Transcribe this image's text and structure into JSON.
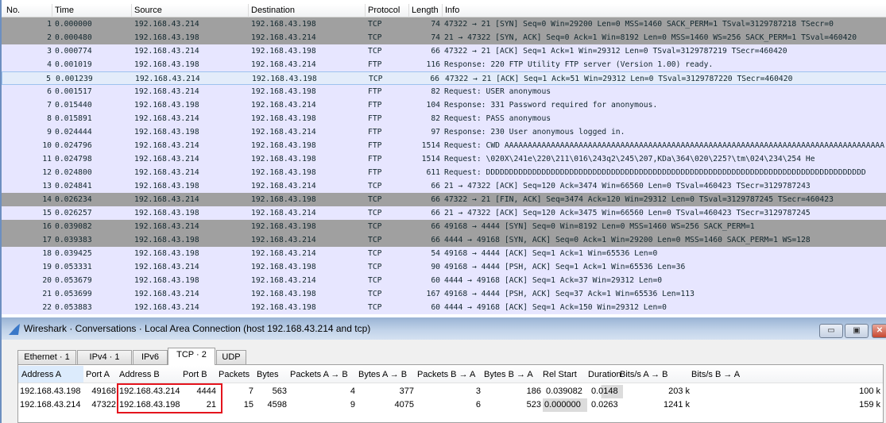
{
  "packet_list": {
    "columns": [
      "No.",
      "Time",
      "Source",
      "Destination",
      "Protocol",
      "Length",
      "Info"
    ],
    "rows": [
      {
        "no": "1",
        "time": "0.000000",
        "src": "192.168.43.214",
        "dst": "192.168.43.198",
        "proto": "TCP",
        "len": "74",
        "info": "47322 → 21 [SYN] Seq=0 Win=29200 Len=0 MSS=1460 SACK_PERM=1 TSval=3129787218 TSecr=0",
        "color": "gray"
      },
      {
        "no": "2",
        "time": "0.000480",
        "src": "192.168.43.198",
        "dst": "192.168.43.214",
        "proto": "TCP",
        "len": "74",
        "info": "21 → 47322 [SYN, ACK] Seq=0 Ack=1 Win=8192 Len=0 MSS=1460 WS=256 SACK_PERM=1 TSval=460420",
        "color": "gray"
      },
      {
        "no": "3",
        "time": "0.000774",
        "src": "192.168.43.214",
        "dst": "192.168.43.198",
        "proto": "TCP",
        "len": "66",
        "info": "47322 → 21 [ACK] Seq=1 Ack=1 Win=29312 Len=0 TSval=3129787219 TSecr=460420",
        "color": "lavender"
      },
      {
        "no": "4",
        "time": "0.001019",
        "src": "192.168.43.198",
        "dst": "192.168.43.214",
        "proto": "FTP",
        "len": "116",
        "info": "Response: 220 FTP Utility FTP server (Version 1.00) ready.",
        "color": "lavender"
      },
      {
        "no": "5",
        "time": "0.001239",
        "src": "192.168.43.214",
        "dst": "192.168.43.198",
        "proto": "TCP",
        "len": "66",
        "info": "47322 → 21 [ACK] Seq=1 Ack=51 Win=29312 Len=0 TSval=3129787220 TSecr=460420",
        "color": "selected"
      },
      {
        "no": "6",
        "time": "0.001517",
        "src": "192.168.43.214",
        "dst": "192.168.43.198",
        "proto": "FTP",
        "len": "82",
        "info": "Request: USER anonymous",
        "color": "lavender"
      },
      {
        "no": "7",
        "time": "0.015440",
        "src": "192.168.43.198",
        "dst": "192.168.43.214",
        "proto": "FTP",
        "len": "104",
        "info": "Response: 331 Password required for anonymous.",
        "color": "lavender"
      },
      {
        "no": "8",
        "time": "0.015891",
        "src": "192.168.43.214",
        "dst": "192.168.43.198",
        "proto": "FTP",
        "len": "82",
        "info": "Request: PASS anonymous",
        "color": "lavender"
      },
      {
        "no": "9",
        "time": "0.024444",
        "src": "192.168.43.198",
        "dst": "192.168.43.214",
        "proto": "FTP",
        "len": "97",
        "info": "Response: 230 User anonymous logged in.",
        "color": "lavender"
      },
      {
        "no": "10",
        "time": "0.024796",
        "src": "192.168.43.214",
        "dst": "192.168.43.198",
        "proto": "FTP",
        "len": "1514",
        "info": "Request: CWD AAAAAAAAAAAAAAAAAAAAAAAAAAAAAAAAAAAAAAAAAAAAAAAAAAAAAAAAAAAAAAAAAAAAAAAAAAAAAAAAAA",
        "color": "lavender"
      },
      {
        "no": "11",
        "time": "0.024798",
        "src": "192.168.43.214",
        "dst": "192.168.43.198",
        "proto": "FTP",
        "len": "1514",
        "info": "Request: \\020X\\241e\\220\\211\\016\\243q2\\245\\207,KDa\\364\\020\\225?\\tm\\024\\234\\254 He",
        "color": "lavender"
      },
      {
        "no": "12",
        "time": "0.024800",
        "src": "192.168.43.214",
        "dst": "192.168.43.198",
        "proto": "FTP",
        "len": "611",
        "info": "Request: DDDDDDDDDDDDDDDDDDDDDDDDDDDDDDDDDDDDDDDDDDDDDDDDDDDDDDDDDDDDDDDDDDDDDDDDDDDDDDDDDD",
        "color": "lavender"
      },
      {
        "no": "13",
        "time": "0.024841",
        "src": "192.168.43.198",
        "dst": "192.168.43.214",
        "proto": "TCP",
        "len": "66",
        "info": "21 → 47322 [ACK] Seq=120 Ack=3474 Win=66560 Len=0 TSval=460423 TSecr=3129787243",
        "color": "lavender"
      },
      {
        "no": "14",
        "time": "0.026234",
        "src": "192.168.43.214",
        "dst": "192.168.43.198",
        "proto": "TCP",
        "len": "66",
        "info": "47322 → 21 [FIN, ACK] Seq=3474 Ack=120 Win=29312 Len=0 TSval=3129787245 TSecr=460423",
        "color": "gray"
      },
      {
        "no": "15",
        "time": "0.026257",
        "src": "192.168.43.198",
        "dst": "192.168.43.214",
        "proto": "TCP",
        "len": "66",
        "info": "21 → 47322 [ACK] Seq=120 Ack=3475 Win=66560 Len=0 TSval=460423 TSecr=3129787245",
        "color": "lavender"
      },
      {
        "no": "16",
        "time": "0.039082",
        "src": "192.168.43.214",
        "dst": "192.168.43.198",
        "proto": "TCP",
        "len": "66",
        "info": "49168 → 4444 [SYN] Seq=0 Win=8192 Len=0 MSS=1460 WS=256 SACK_PERM=1",
        "color": "gray"
      },
      {
        "no": "17",
        "time": "0.039383",
        "src": "192.168.43.198",
        "dst": "192.168.43.214",
        "proto": "TCP",
        "len": "66",
        "info": "4444 → 49168 [SYN, ACK] Seq=0 Ack=1 Win=29200 Len=0 MSS=1460 SACK_PERM=1 WS=128",
        "color": "gray"
      },
      {
        "no": "18",
        "time": "0.039425",
        "src": "192.168.43.198",
        "dst": "192.168.43.214",
        "proto": "TCP",
        "len": "54",
        "info": "49168 → 4444 [ACK] Seq=1 Ack=1 Win=65536 Len=0",
        "color": "lavender"
      },
      {
        "no": "19",
        "time": "0.053331",
        "src": "192.168.43.214",
        "dst": "192.168.43.198",
        "proto": "TCP",
        "len": "90",
        "info": "49168 → 4444 [PSH, ACK] Seq=1 Ack=1 Win=65536 Len=36",
        "color": "lavender"
      },
      {
        "no": "20",
        "time": "0.053679",
        "src": "192.168.43.198",
        "dst": "192.168.43.214",
        "proto": "TCP",
        "len": "60",
        "info": "4444 → 49168 [ACK] Seq=1 Ack=37 Win=29312 Len=0",
        "color": "lavender"
      },
      {
        "no": "21",
        "time": "0.053699",
        "src": "192.168.43.214",
        "dst": "192.168.43.198",
        "proto": "TCP",
        "len": "167",
        "info": "49168 → 4444 [PSH, ACK] Seq=37 Ack=1 Win=65536 Len=113",
        "color": "lavender"
      },
      {
        "no": "22",
        "time": "0.053883",
        "src": "192.168.43.214",
        "dst": "192.168.43.198",
        "proto": "TCP",
        "len": "60",
        "info": "4444 → 49168 [ACK] Seq=1 Ack=150 Win=29312 Len=0",
        "color": "lavender"
      }
    ]
  },
  "dialog": {
    "title": "Wireshark · Conversations · Local Area Connection (host 192.168.43.214 and tcp)",
    "window_buttons": {
      "minimize": "▭",
      "maximize": "▣",
      "close": "✕"
    },
    "tabs": [
      "Ethernet · 1",
      "IPv4 · 1",
      "IPv6",
      "TCP · 2",
      "UDP"
    ],
    "active_tab": "TCP · 2",
    "columns": [
      "Address A",
      "Port A",
      "Address B",
      "Port B",
      "Packets",
      "Bytes",
      "Packets A → B",
      "Bytes A → B",
      "Packets B → A",
      "Bytes B → A",
      "Rel Start",
      "Duration",
      "Bits/s A → B",
      "Bits/s B → A"
    ],
    "rows": [
      [
        "192.168.43.198",
        "49168",
        "192.168.43.214",
        "4444",
        "7",
        "563",
        "4",
        "377",
        "3",
        "186",
        "0.039082",
        "0.0148",
        "203 k",
        "100 k"
      ],
      [
        "192.168.43.214",
        "47322",
        "192.168.43.198",
        "21",
        "15",
        "4598",
        "9",
        "4075",
        "6",
        "523",
        "0.000000",
        "0.0263",
        "1241 k",
        "159 k"
      ]
    ]
  },
  "colors": {
    "gray_row": "#a0a0a0",
    "lavender_row": "#e7e6ff",
    "highlight_box": "#e4141d"
  }
}
